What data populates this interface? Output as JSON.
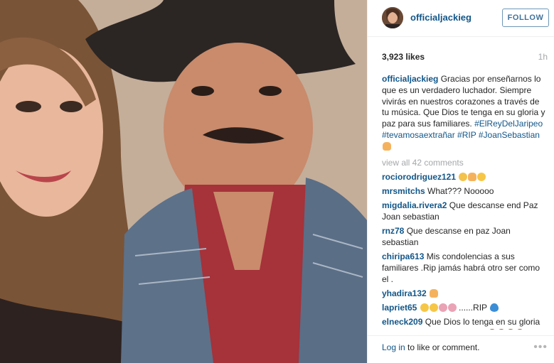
{
  "post": {
    "username": "officialjackieg",
    "follow_label": "FOLLOW",
    "likes": "3,923 likes",
    "time_ago": "1h",
    "caption_user": "officialjackieg",
    "caption_text": "Gracias por enseñarnos lo que es un verdadero luchador. Siempre vivirás en nuestros corazones a través de tu música. Que Dios te tenga en su gloria y paz para sus familiares.",
    "caption_tags": "#ElReyDelJaripeo #tevamosaextrañar #RIP #JoanSebastian",
    "view_all": "view all 42 comments"
  },
  "comments": [
    {
      "user": "rociorodriguez121",
      "text": ""
    },
    {
      "user": "mrsmitchs",
      "text": "What??? Nooooo"
    },
    {
      "user": "migdalia.rivera2",
      "text": "Que descanse end Paz Joan sebastian"
    },
    {
      "user": "rnz78",
      "text": "Que descanse en paz Joan sebastian"
    },
    {
      "user": "chiripa613",
      "text": "Mis condolencias a sus familiares .Rip jamás habrá otro ser como el ."
    },
    {
      "user": "yhadira132",
      "text": ""
    },
    {
      "user": "lapriet65",
      "text": "......RIP"
    },
    {
      "user": "elneck209",
      "text": "Que Dios lo tenga en su gloria gran hombre gran cantante"
    }
  ],
  "footer": {
    "login_label": "Log in",
    "login_rest": " to like or comment.",
    "more_icon": "more-options-icon"
  },
  "colors": {
    "link_blue": "#125688",
    "follow_border": "#6f97b6",
    "muted_gray": "#a5a7aa"
  }
}
